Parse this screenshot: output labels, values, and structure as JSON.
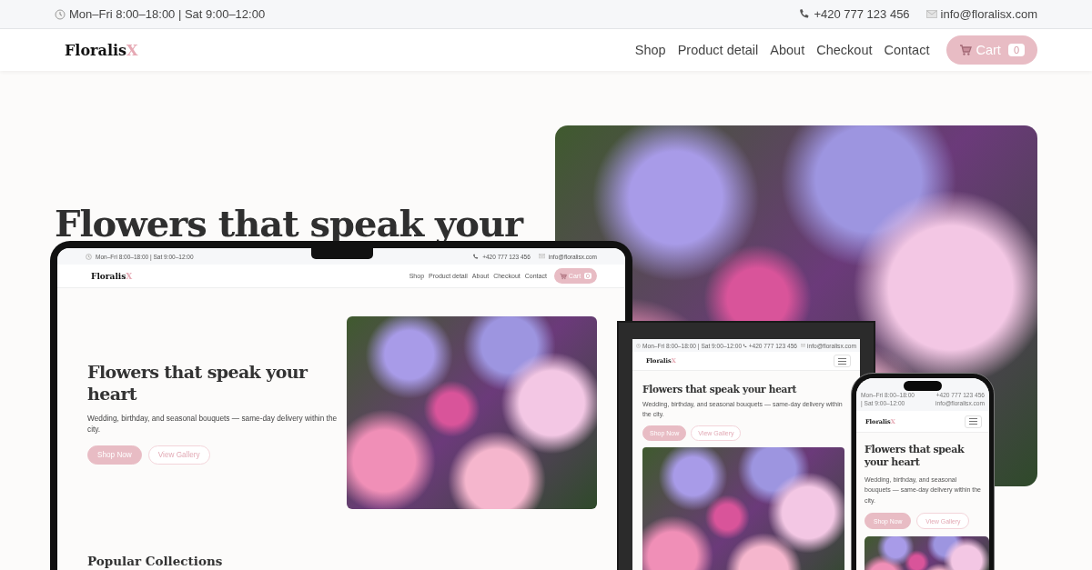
{
  "top_bar": {
    "hours": "Mon–Fri 8:00–18:00 | Sat 9:00–12:00",
    "phone": "+420 777 123 456",
    "email": "info@floralisx.com"
  },
  "nav": {
    "logo": "Floralis",
    "logo_accent": "X",
    "links": [
      "Shop",
      "Product detail",
      "About",
      "Checkout",
      "Contact"
    ],
    "cart": {
      "label": "Cart",
      "count": "0"
    }
  },
  "hero": {
    "title": "Flowers that speak your"
  },
  "mockups": [
    {
      "kind": "laptop",
      "top_bar": {
        "hours": "Mon–Fri 8:00–18:00 | Sat 9:00–12:00",
        "phone": "+420 777 123 456",
        "email": "info@floralisx.com"
      },
      "nav": {
        "logo": "Floralis",
        "logo_accent": "X",
        "links": [
          "Shop",
          "Product detail",
          "About",
          "Checkout",
          "Contact"
        ],
        "cart": {
          "label": "Cart",
          "count": "0"
        }
      },
      "hero": {
        "title": "Flowers that speak your heart",
        "subtitle": "Wedding, birthday, and seasonal bouquets — same-day delivery within the city.",
        "buttons": [
          "Shop Now",
          "View Gallery"
        ]
      },
      "section_title": "Popular Collections"
    },
    {
      "kind": "tablet",
      "top_bar": {
        "hours": "Mon–Fri 8:00–18:00 | Sat 9:00–12:00",
        "phone": "+420 777 123 456",
        "email": "info@floralisx.com"
      },
      "nav": {
        "logo": "Floralis",
        "logo_accent": "X"
      },
      "hero": {
        "title": "Flowers that speak your heart",
        "subtitle": "Wedding, birthday, and seasonal bouquets — same-day delivery within the city.",
        "buttons": [
          "Shop Now",
          "View Gallery"
        ]
      }
    },
    {
      "kind": "phone",
      "top_bar": {
        "hours": "Mon–Fri 8:00–18:00 | Sat 9:00–12:00",
        "phone": "+420 777 123 456",
        "email": "info@floralisx.com"
      },
      "nav": {
        "logo": "Floralis",
        "logo_accent": "X"
      },
      "hero": {
        "title": "Flowers that speak your heart",
        "subtitle": "Wedding, birthday, and seasonal bouquets — same-day delivery within the city.",
        "buttons": [
          "Shop Now",
          "View Gallery"
        ]
      }
    }
  ]
}
